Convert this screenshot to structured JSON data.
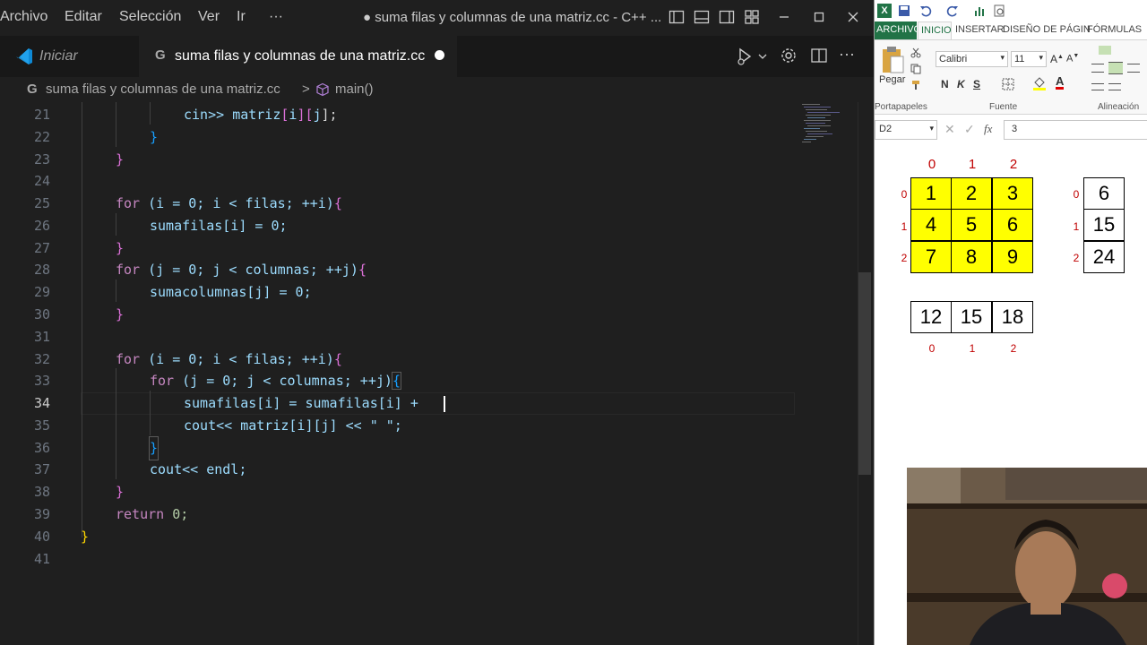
{
  "vscode": {
    "menu": [
      "Archivo",
      "Editar",
      "Selección",
      "Ver",
      "Ir",
      "···"
    ],
    "window_title": "● suma filas y columnas de una matriz.cc - C++ ...",
    "tabs": {
      "welcome": "Iniciar",
      "file": "suma filas y columnas de una matriz.cc"
    },
    "breadcrumb": {
      "file": "suma filas y columnas de una matriz.cc",
      "separator": ">",
      "symbol": "main()"
    },
    "line_numbers": [
      "21",
      "22",
      "23",
      "24",
      "25",
      "26",
      "27",
      "28",
      "29",
      "30",
      "31",
      "32",
      "33",
      "34",
      "35",
      "36",
      "37",
      "38",
      "39",
      "40",
      "41"
    ],
    "active_line": "34",
    "code": {
      "l21a": "cin>> ",
      "l21b": "matriz",
      "l21c": "[",
      "l21d": "i",
      "l21e": "][",
      "l21f": "j",
      "l21g": "];",
      "l22": "}",
      "l23": "}",
      "l25_for": "for",
      "l25_rest": " (i = 0; i < filas; ++i)",
      "l25_br": "{",
      "l26": "sumafilas[i] = 0;",
      "l27": "}",
      "l28_for": "for",
      "l28_rest": " (j = 0; j < columnas; ++j)",
      "l28_br": "{",
      "l29": "sumacolumnas[j] = 0;",
      "l30": "}",
      "l32_for": "for",
      "l32_rest": " (i = 0; i < filas; ++i)",
      "l32_br": "{",
      "l33_for": "for",
      "l33_rest": " (j = 0; j < columnas; ++j)",
      "l33_br": "{",
      "l34": "sumafilas[i] = sumafilas[i] + ",
      "l35": "cout<< matriz[i][j] << \" \";",
      "l36": "}",
      "l37": "cout<< endl;",
      "l38": "}",
      "l39_ret": "return",
      "l39_rest": " 0;",
      "l40": "}"
    }
  },
  "excel": {
    "ribbon_tabs": [
      "ARCHIVO",
      "INICIO",
      "INSERTAR",
      "DISEÑO DE PÁGIN",
      "FÓRMULAS"
    ],
    "paste_label": "Pegar",
    "font_name": "Calibri",
    "font_size": "11",
    "group_labels": [
      "Portapapeles",
      "Fuente",
      "Alineación"
    ],
    "format_buttons": [
      "N",
      "K",
      "S"
    ],
    "name_box": "D2",
    "formula_value": "3",
    "col_indices": [
      "0",
      "1",
      "2"
    ],
    "row_indices": [
      "0",
      "1",
      "2"
    ],
    "matrix": [
      [
        "1",
        "2",
        "3"
      ],
      [
        "4",
        "5",
        "6"
      ],
      [
        "7",
        "8",
        "9"
      ]
    ],
    "row_sums": [
      "6",
      "15",
      "24"
    ],
    "col_sums": [
      "12",
      "15",
      "18"
    ],
    "matrix_fill_color": "#ffff00",
    "index_color": "#c00000"
  },
  "colors": {
    "editor_bg": "#1f1f1f",
    "keyword": "#c586c0",
    "variable": "#9cdcfe",
    "number": "#b5cea8",
    "string": "#ce9178",
    "excel_accent": "#217346"
  }
}
